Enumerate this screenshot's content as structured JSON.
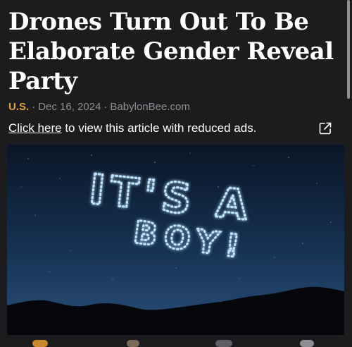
{
  "article": {
    "headline": "Drones Turn Out To Be Elaborate Gender Reveal Party",
    "category": "U.S.",
    "separator": "·",
    "date": "Dec 16, 2024",
    "source": "BabylonBee.com",
    "ads_link_label": "Click here",
    "ads_text": " to view this article with reduced ads.",
    "external_icon": "external-link-icon"
  },
  "image": {
    "line1": "IT'S A",
    "line2": "BOY!",
    "description_colors": {
      "sky_top": "#0a1626",
      "sky_bottom": "#2b4f7a",
      "drone_light": "#a9d8ff",
      "mountains": "#05070b"
    }
  },
  "colors": {
    "background": "#1c1c1e",
    "category": "#d9a441",
    "meta": "#8e8e93"
  }
}
